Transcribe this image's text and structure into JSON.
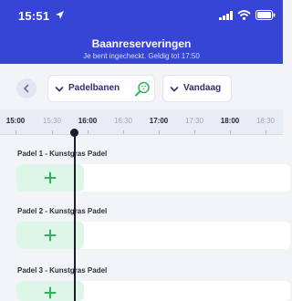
{
  "status_bar": {
    "time": "15:51"
  },
  "header": {
    "title": "Baanreserveringen",
    "subtitle": "Je bent ingecheckt. Geldig tot 17:50"
  },
  "filters": {
    "courts_label": "Padelbanen",
    "date_label": "Vandaag"
  },
  "timeline": {
    "ticks": [
      {
        "label": "15:00",
        "major": true
      },
      {
        "label": "15:30",
        "major": false
      },
      {
        "label": "16:00",
        "major": true
      },
      {
        "label": "16:30",
        "major": false
      },
      {
        "label": "17:00",
        "major": true
      },
      {
        "label": "17:30",
        "major": false
      },
      {
        "label": "18:00",
        "major": true
      },
      {
        "label": "18:30",
        "major": false
      }
    ]
  },
  "courts": [
    {
      "name": "Padel 1 - Kunstgras Padel"
    },
    {
      "name": "Padel 2 - Kunstgras Padel"
    },
    {
      "name": "Padel 3 - Kunstgras Padel"
    }
  ],
  "colors": {
    "header": "#3645d6",
    "add_slot": "#def6e7",
    "plus": "#2fb35f",
    "now_line": "#1b1d2a"
  }
}
